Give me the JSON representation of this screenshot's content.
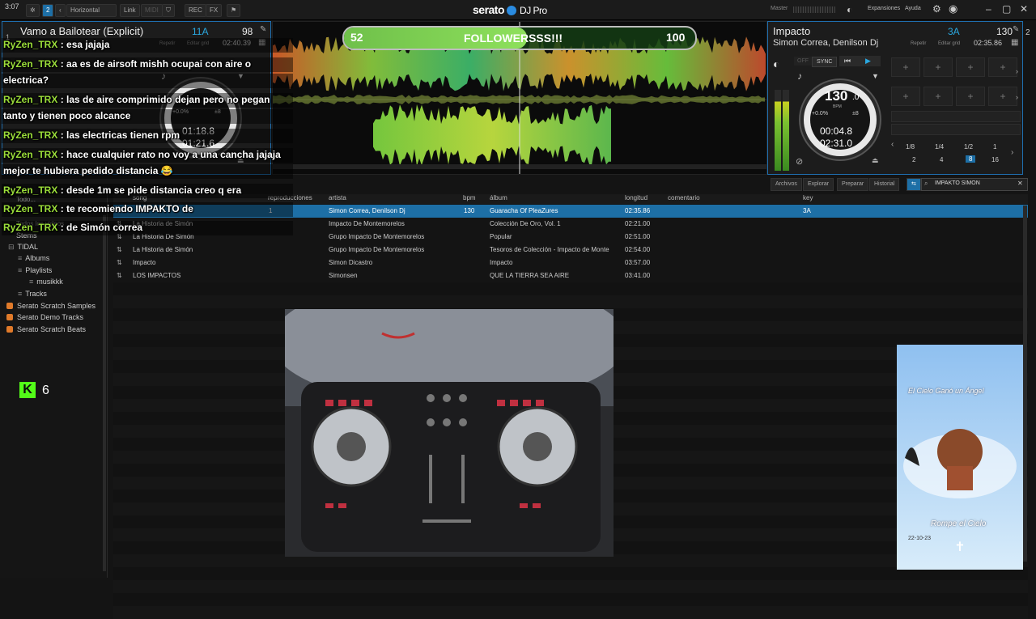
{
  "app": {
    "brand": "serato",
    "brand_suffix": "DJ Pro",
    "clock": "3:07"
  },
  "topbar": {
    "deck_count": "2",
    "layout": "Horizontal",
    "link": "Link",
    "midi": "MIDI",
    "rec": "REC",
    "fx": "FX",
    "master": "Master",
    "expansions": "Expansiones",
    "help": "Ayuda"
  },
  "deck_left": {
    "title": "Vamo a Bailotear (Explicit)",
    "key": "11A",
    "bpm": "98",
    "repeat": "Repetir",
    "edit_grid": "Editar grid",
    "total_time": "02:40.39",
    "elapsed": "01:18.8",
    "remaining": "01:21.6",
    "pitch": "+0.0%",
    "range": "±8",
    "deck_num": "1"
  },
  "deck_right": {
    "title": "Impacto",
    "artist": "Simon Correa, Denilson Dj",
    "key": "3A",
    "bpm": "130",
    "repeat": "Repetir",
    "edit_grid": "Editar grid",
    "total_time": "02:35.86",
    "platter_bpm": "130",
    "platter_bpm_dec": ".0",
    "bpm_unit": "BPM",
    "pitch": "+0.0%",
    "range": "±8",
    "elapsed": "00:04.8",
    "remaining": "02:31.0",
    "sync": "SYNC",
    "off": "OFF",
    "deck_num": "2",
    "loops_row1": [
      "1/8",
      "1/4",
      "1/2",
      "1"
    ],
    "loops_row2": [
      "2",
      "4",
      "8",
      "16"
    ],
    "pads": [
      "+",
      "+",
      "+",
      "+",
      "+",
      "+",
      "+",
      "+"
    ]
  },
  "banner": {
    "left": "52",
    "label": "FOLLOWERSSS!!!",
    "right": "100",
    "progress": 0.52
  },
  "library_tabs": {
    "files": "Archivos",
    "browse": "Explorar",
    "prepare": "Preparar",
    "history": "Historial",
    "search": "IMPAKTO SIMON"
  },
  "sidebar": {
    "items": [
      "Todo...",
      "Todos los videos",
      "Stems",
      "TIDAL",
      "Albums",
      "Playlists",
      "musikkk",
      "Tracks",
      "Serato Scratch Samples",
      "Serato Demo Tracks",
      "Serato Scratch Beats"
    ]
  },
  "table": {
    "headers": [
      "song",
      "reproducciones",
      "artista",
      "bpm",
      "álbum",
      "longitud",
      "comentario",
      "key"
    ],
    "rows": [
      {
        "song": "",
        "plays": "1",
        "artist": "Simon Correa, Denilson Dj",
        "bpm": "130",
        "album": "Guaracha Of PleaZures",
        "length": "02:35.86",
        "comment": "",
        "key": "3A",
        "selected": true
      },
      {
        "song": "La Historia de Simón",
        "plays": "",
        "artist": "Impacto De Montemorelos",
        "bpm": "",
        "album": "Colección De Oro, Vol. 1",
        "length": "02:21.00",
        "comment": "",
        "key": ""
      },
      {
        "song": "La Historia De Simón",
        "plays": "",
        "artist": "Grupo Impacto De Montemorelos",
        "bpm": "",
        "album": "Popular",
        "length": "02:51.00",
        "comment": "",
        "key": ""
      },
      {
        "song": "La Historia de Simón",
        "plays": "",
        "artist": "Grupo Impacto De Montemorelos",
        "bpm": "",
        "album": "Tesoros de Colección - Impacto de Monte",
        "length": "02:54.00",
        "comment": "",
        "key": ""
      },
      {
        "song": "Impacto",
        "plays": "",
        "artist": "Simon Dicastro",
        "bpm": "",
        "album": "Impacto",
        "length": "03:57.00",
        "comment": "",
        "key": ""
      },
      {
        "song": "LOS IMPACTOS",
        "plays": "",
        "artist": "Simonsen",
        "bpm": "",
        "album": "QUE LA TIERRA SEA AIRE",
        "length": "03:41.00",
        "comment": "",
        "key": ""
      }
    ]
  },
  "chat": [
    {
      "user": "RyZen_TRX",
      "text": " : esa jajaja"
    },
    {
      "user": "RyZen_TRX",
      "text": " : aa es de airsoft mishh ocupai con aire o"
    },
    {
      "user": "",
      "text": "electrica?"
    },
    {
      "user": "RyZen_TRX",
      "text": " : las de aire comprimido dejan pero no pegan"
    },
    {
      "user": "",
      "text": "tanto y tienen poco alcance"
    },
    {
      "user": "RyZen_TRX",
      "text": " : las electricas tienen rpm"
    },
    {
      "user": "RyZen_TRX",
      "text": " : hace cualquier rato no voy a una cancha jajaja"
    },
    {
      "user": "",
      "text": "mejor te hubiera pedido distancia 😂"
    },
    {
      "user": "RyZen_TRX",
      "text": " : desde 1m se pide distancia creo q era"
    },
    {
      "user": "RyZen_TRX",
      "text": " : te recomiendo IMPAKTO de"
    },
    {
      "user": "RyZen_TRX",
      "text": " : de Simón correa"
    }
  ],
  "kick": {
    "logo": "K",
    "count": "6"
  },
  "poster": {
    "top_text": "El Cielo Ganó un Ángel",
    "bottom_text": "Rompe el Cielo",
    "date": "22-10-23"
  },
  "colors": {
    "accent": "#1d6fa6",
    "chat_user": "#9bde3a",
    "key_blue": "#2aa8e0",
    "kick_green": "#53fc18"
  }
}
